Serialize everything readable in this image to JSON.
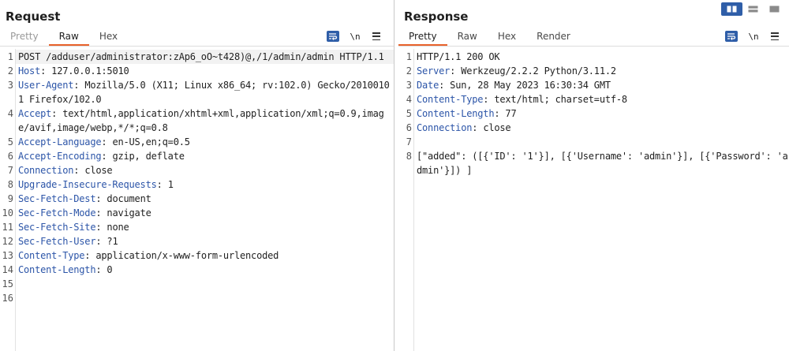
{
  "request": {
    "title": "Request",
    "tabs": [
      {
        "label": "Pretty",
        "state": "muted"
      },
      {
        "label": "Raw",
        "state": "active"
      },
      {
        "label": "Hex",
        "state": "normal"
      }
    ],
    "tools": {
      "wrap_icon": "wrap-lines-icon",
      "newline_label": "\\n",
      "menu_icon": "menu-icon"
    },
    "lines": [
      {
        "n": "1",
        "value": "POST /adduser/administrator:zAp6_oO~t428)@,/1/admin/admin HTTP/1.1"
      },
      {
        "n": "2",
        "key": "Host",
        "value": "127.0.0.1:5010"
      },
      {
        "n": "3",
        "key": "User-Agent",
        "value": "Mozilla/5.0 (X11; Linux x86_64; rv:102.0) Gecko/20100101 Firefox/102.0"
      },
      {
        "n": "4",
        "key": "Accept",
        "value": "text/html,application/xhtml+xml,application/xml;q=0.9,image/avif,image/webp,*/*;q=0.8"
      },
      {
        "n": "5",
        "key": "Accept-Language",
        "value": "en-US,en;q=0.5"
      },
      {
        "n": "6",
        "key": "Accept-Encoding",
        "value": "gzip, deflate"
      },
      {
        "n": "7",
        "key": "Connection",
        "value": "close"
      },
      {
        "n": "8",
        "key": "Upgrade-Insecure-Requests",
        "value": "1"
      },
      {
        "n": "9",
        "key": "Sec-Fetch-Dest",
        "value": "document"
      },
      {
        "n": "10",
        "key": "Sec-Fetch-Mode",
        "value": "navigate"
      },
      {
        "n": "11",
        "key": "Sec-Fetch-Site",
        "value": "none"
      },
      {
        "n": "12",
        "key": "Sec-Fetch-User",
        "value": "?1"
      },
      {
        "n": "13",
        "key": "Content-Type",
        "value": "application/x-www-form-urlencoded"
      },
      {
        "n": "14",
        "key": "Content-Length",
        "value": "0"
      },
      {
        "n": "15",
        "value": ""
      },
      {
        "n": "16",
        "value": ""
      }
    ]
  },
  "response": {
    "title": "Response",
    "tabs": [
      {
        "label": "Pretty",
        "state": "active"
      },
      {
        "label": "Raw",
        "state": "normal"
      },
      {
        "label": "Hex",
        "state": "normal"
      },
      {
        "label": "Render",
        "state": "normal"
      }
    ],
    "tools": {
      "wrap_icon": "wrap-lines-icon",
      "newline_label": "\\n",
      "menu_icon": "menu-icon"
    },
    "lines": [
      {
        "n": "1",
        "value": "HTTP/1.1 200 OK"
      },
      {
        "n": "2",
        "key": "Server",
        "value": "Werkzeug/2.2.2 Python/3.11.2"
      },
      {
        "n": "3",
        "key": "Date",
        "value": "Sun, 28 May 2023 16:30:34 GMT"
      },
      {
        "n": "4",
        "key": "Content-Type",
        "value": "text/html; charset=utf-8"
      },
      {
        "n": "5",
        "key": "Content-Length",
        "value": "77"
      },
      {
        "n": "6",
        "key": "Connection",
        "value": "close"
      },
      {
        "n": "7",
        "value": ""
      },
      {
        "n": "8",
        "value": "[\"added\": ([{'ID': '1'}], [{'Username': 'admin'}], [{'Password': 'admin'}]) ]"
      }
    ]
  },
  "layout_switch": [
    "split-vertical-icon",
    "split-horizontal-icon",
    "single-pane-icon"
  ],
  "colors": {
    "accent": "#e8622b",
    "brand_blue": "#2f5ea8",
    "header_key": "#2c55a8"
  }
}
